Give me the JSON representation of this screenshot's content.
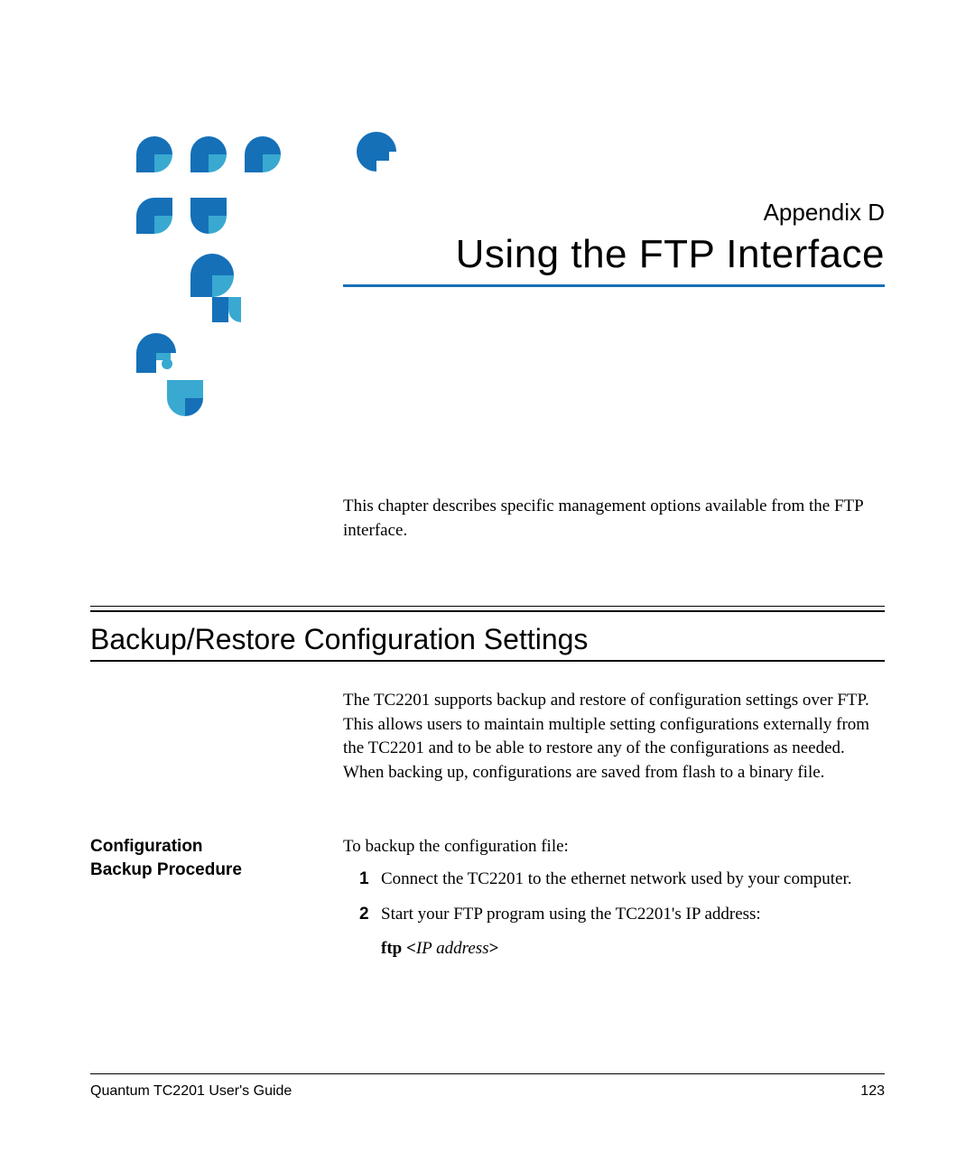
{
  "header": {
    "appendix": "Appendix D",
    "title": "Using the FTP Interface"
  },
  "intro": "This chapter describes specific management options available from the FTP interface.",
  "section": {
    "title": "Backup/Restore Configuration Settings",
    "body": "The TC2201 supports backup and restore of configuration settings over FTP. This allows users to maintain multiple setting configurations externally from the TC2201 and to be able to restore any of the configurations as needed. When backing up, configurations are saved from flash to a binary file."
  },
  "subsection": {
    "title_line1": "Configuration",
    "title_line2": "Backup Procedure",
    "lead": "To backup the configuration file:",
    "steps": [
      {
        "num": "1",
        "text": "Connect the TC2201 to the ethernet network used by your computer."
      },
      {
        "num": "2",
        "text": "Start your FTP program using the TC2201's IP address:"
      }
    ],
    "ftp_prefix": "ftp <",
    "ftp_addr": "IP address",
    "ftp_suffix": ">"
  },
  "footer": {
    "guide": "Quantum TC2201 User's Guide",
    "page": "123"
  },
  "colors": {
    "brand_blue": "#1570b8",
    "brand_cyan": "#39a9d1"
  }
}
